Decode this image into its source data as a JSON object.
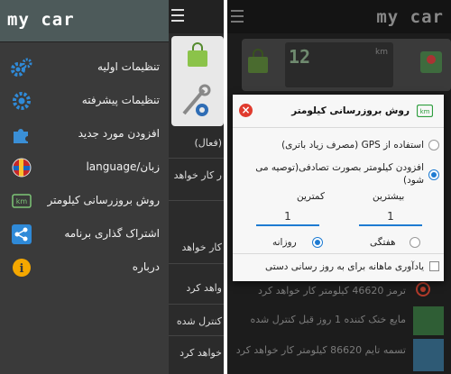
{
  "app": {
    "logo": "my car"
  },
  "drawer": {
    "items": [
      {
        "label": "تنظیمات اولیه",
        "icon": "gears-icon"
      },
      {
        "label": "تنظیمات پیشرفته",
        "icon": "settings-gear-icon"
      },
      {
        "label": "افزودن مورد جدید",
        "icon": "puzzle-icon"
      },
      {
        "label": "زبان/language",
        "icon": "globe-flags-icon"
      },
      {
        "label": "روش بروزرسانی کیلومتر",
        "icon": "km-icon"
      },
      {
        "label": "اشتراک گذاری برنامه",
        "icon": "share-icon"
      },
      {
        "label": "درباره",
        "icon": "info-icon"
      }
    ]
  },
  "left_background": {
    "rows": [
      "(فعال)",
      "ر کار خواهد",
      "کار خواهد",
      "واهد کرد",
      "کنترل شده",
      "خواهد کرد"
    ]
  },
  "right_background": {
    "rows": [
      "ترمز 46620 کیلومتر کار خواهد کرد",
      "مایع خنک کننده 1 روز قبل کنترل شده",
      "تسمه تایم 86620 کیلومتر کار خواهد کرد"
    ],
    "odometer_digits": "12",
    "km_badge": "km"
  },
  "dialog": {
    "title": "روش بروزرسانی کیلومتر",
    "km_badge": "km",
    "option_gps": "استفاده از GPS (مصرف زیاد باتری)",
    "option_random": "افزودن کیلومتر بصورت تصادفی(توصیه می شود)",
    "min_label": "کمترین",
    "max_label": "بیشترین",
    "min_value": "1",
    "max_value": "1",
    "daily_label": "روزانه",
    "weekly_label": "هفتگی",
    "reminder_label": "یادآوری ماهانه برای به روز رسانی دستی",
    "selected_method": "random",
    "selected_period": "daily",
    "reminder_checked": false
  },
  "colors": {
    "accent": "#1e7bd2",
    "close": "#e03b2e",
    "header": "#4d5a5a"
  }
}
